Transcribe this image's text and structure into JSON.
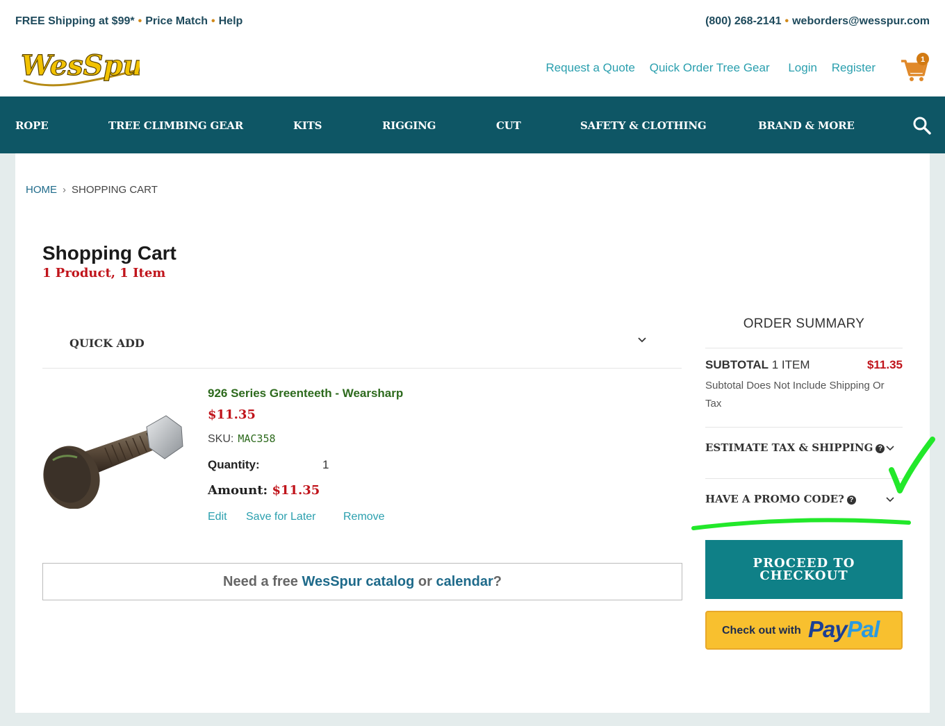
{
  "topbar": {
    "left": [
      "FREE Shipping at $99*",
      "Price Match",
      "Help"
    ],
    "phone": "(800) 268-2141",
    "email": "weborders@wesspur.com",
    "separator": "•"
  },
  "header": {
    "logo_text": "WesSpur",
    "links": [
      "Request a Quote",
      "Quick Order Tree Gear",
      "Login",
      "Register"
    ],
    "cart_count": "1"
  },
  "nav": {
    "items": [
      "ROPE",
      "TREE CLIMBING GEAR",
      "KITS",
      "RIGGING",
      "CUT",
      "SAFETY & CLOTHING",
      "BRAND & MORE"
    ]
  },
  "breadcrumb": {
    "home": "HOME",
    "separator": "›",
    "current": "SHOPPING CART"
  },
  "cart": {
    "title": "Shopping Cart",
    "subtitle": "1 Product, 1 Item",
    "quick_add_label": "QUICK ADD",
    "item": {
      "name": "926 Series Greenteeth - Wearsharp",
      "price": "$11.35",
      "sku_label": "SKU:",
      "sku": "MAC358",
      "quantity_label": "Quantity:",
      "quantity": "1",
      "amount_label": "Amount:",
      "amount": "$11.35",
      "actions": [
        "Edit",
        "Save for Later",
        "Remove"
      ]
    },
    "catalog": {
      "prefix": "Need a free",
      "link1": "WesSpur catalog",
      "middle": "or",
      "link2": "calendar",
      "suffix": "?"
    }
  },
  "summary": {
    "title": "ORDER SUMMARY",
    "subtotal_label": "SUBTOTAL",
    "subtotal_count": "1 ITEM",
    "subtotal_value": "$11.35",
    "subtotal_note": "Subtotal Does Not Include Shipping Or Tax",
    "estimate_label": "ESTIMATE TAX & SHIPPING",
    "promo_label": "HAVE A PROMO CODE?",
    "checkout_line1": "PROCEED TO",
    "checkout_line2": "CHECKOUT",
    "paypal_prefix": "Check out with",
    "paypal_a": "Pay",
    "paypal_b": "Pal"
  },
  "colors": {
    "nav_bg": "#0e5665",
    "accent_teal": "#2a9fae",
    "price_red": "#c0141b",
    "product_green": "#2d6a1d",
    "checkout_bg": "#0f8087",
    "paypal_yellow": "#f8c02f",
    "annotation_green": "#22e82a"
  },
  "icons": {
    "cart": "shopping-cart-icon",
    "search": "search-icon",
    "chevron": "chevron-down-icon",
    "help": "question-circle-icon"
  }
}
